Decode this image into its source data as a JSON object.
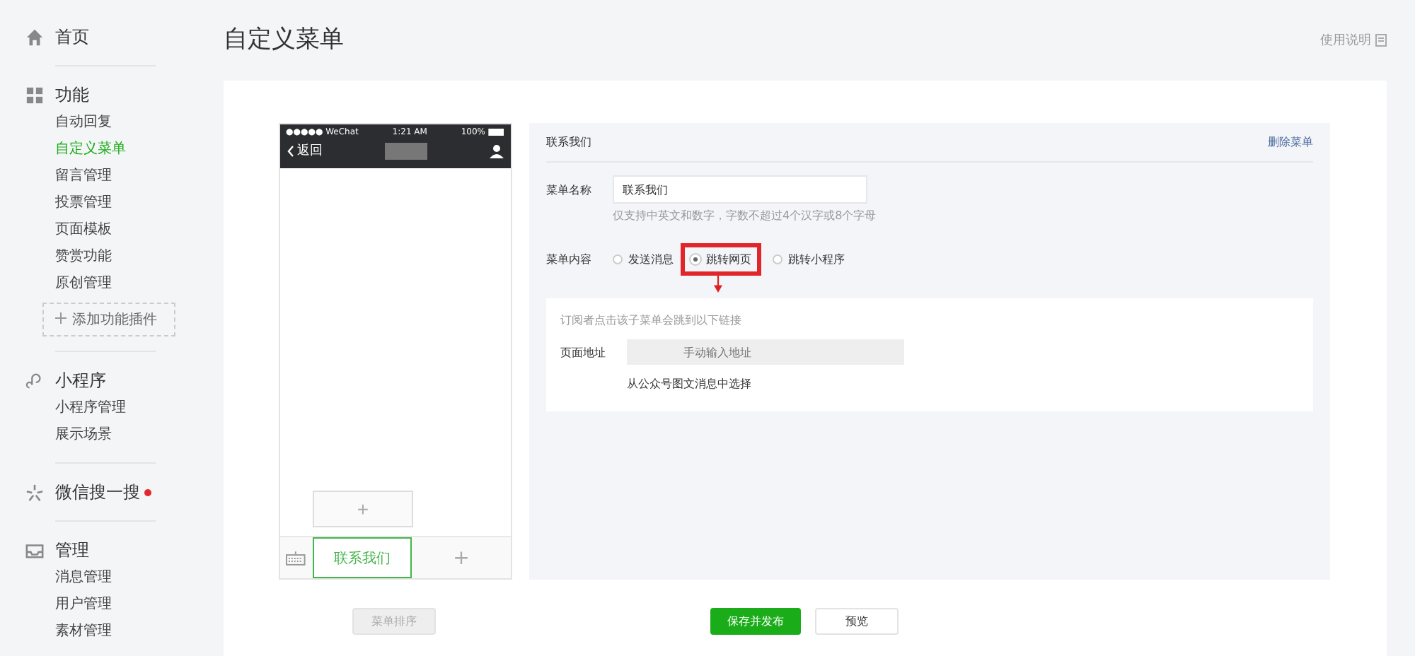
{
  "sidebar": {
    "sections": [
      {
        "title": "首页"
      },
      {
        "title": "功能",
        "items": [
          {
            "label": "自动回复",
            "selected": false
          },
          {
            "label": "自定义菜单",
            "selected": true
          },
          {
            "label": "留言管理",
            "selected": false
          },
          {
            "label": "投票管理",
            "selected": false
          },
          {
            "label": "页面模板",
            "selected": false
          },
          {
            "label": "赞赏功能",
            "selected": false
          },
          {
            "label": "原创管理",
            "selected": false
          }
        ],
        "add_button": "添加功能插件"
      },
      {
        "title": "小程序",
        "items": [
          {
            "label": "小程序管理",
            "selected": false
          },
          {
            "label": "展示场景",
            "selected": false
          }
        ]
      },
      {
        "title": "微信搜一搜",
        "badge_dot": true
      },
      {
        "title": "管理",
        "items": [
          {
            "label": "消息管理",
            "selected": false
          },
          {
            "label": "用户管理",
            "selected": false
          },
          {
            "label": "素材管理",
            "selected": false
          }
        ]
      }
    ]
  },
  "page_title": "自定义菜单",
  "help_link": "使用说明",
  "phone": {
    "carrier": "●●●●● WeChat",
    "time": "1:21 AM",
    "battery": "100%",
    "back": "返回",
    "submenu_add": "+",
    "menu_tabs": [
      {
        "label": "联系我们",
        "selected": true
      },
      {
        "label": "+",
        "selected": false
      }
    ]
  },
  "editor": {
    "header": "联系我们",
    "delete_link": "删除菜单",
    "name_label": "菜单名称",
    "name_value": "联系我们",
    "name_hint": "仅支持中英文和数字，字数不超过4个汉字或8个字母",
    "content_label": "菜单内容",
    "options": [
      {
        "label": "发送消息",
        "selected": false
      },
      {
        "label": "跳转网页",
        "selected": true
      },
      {
        "label": "跳转小程序",
        "selected": false
      }
    ],
    "jump_hint": "订阅者点击该子菜单会跳到以下链接",
    "url_label": "页面地址",
    "url_placeholder": "手动输入地址",
    "pick_link": "从公众号图文消息中选择"
  },
  "buttons": {
    "sort": "菜单排序",
    "publish": "保存并发布",
    "preview": "预览"
  }
}
